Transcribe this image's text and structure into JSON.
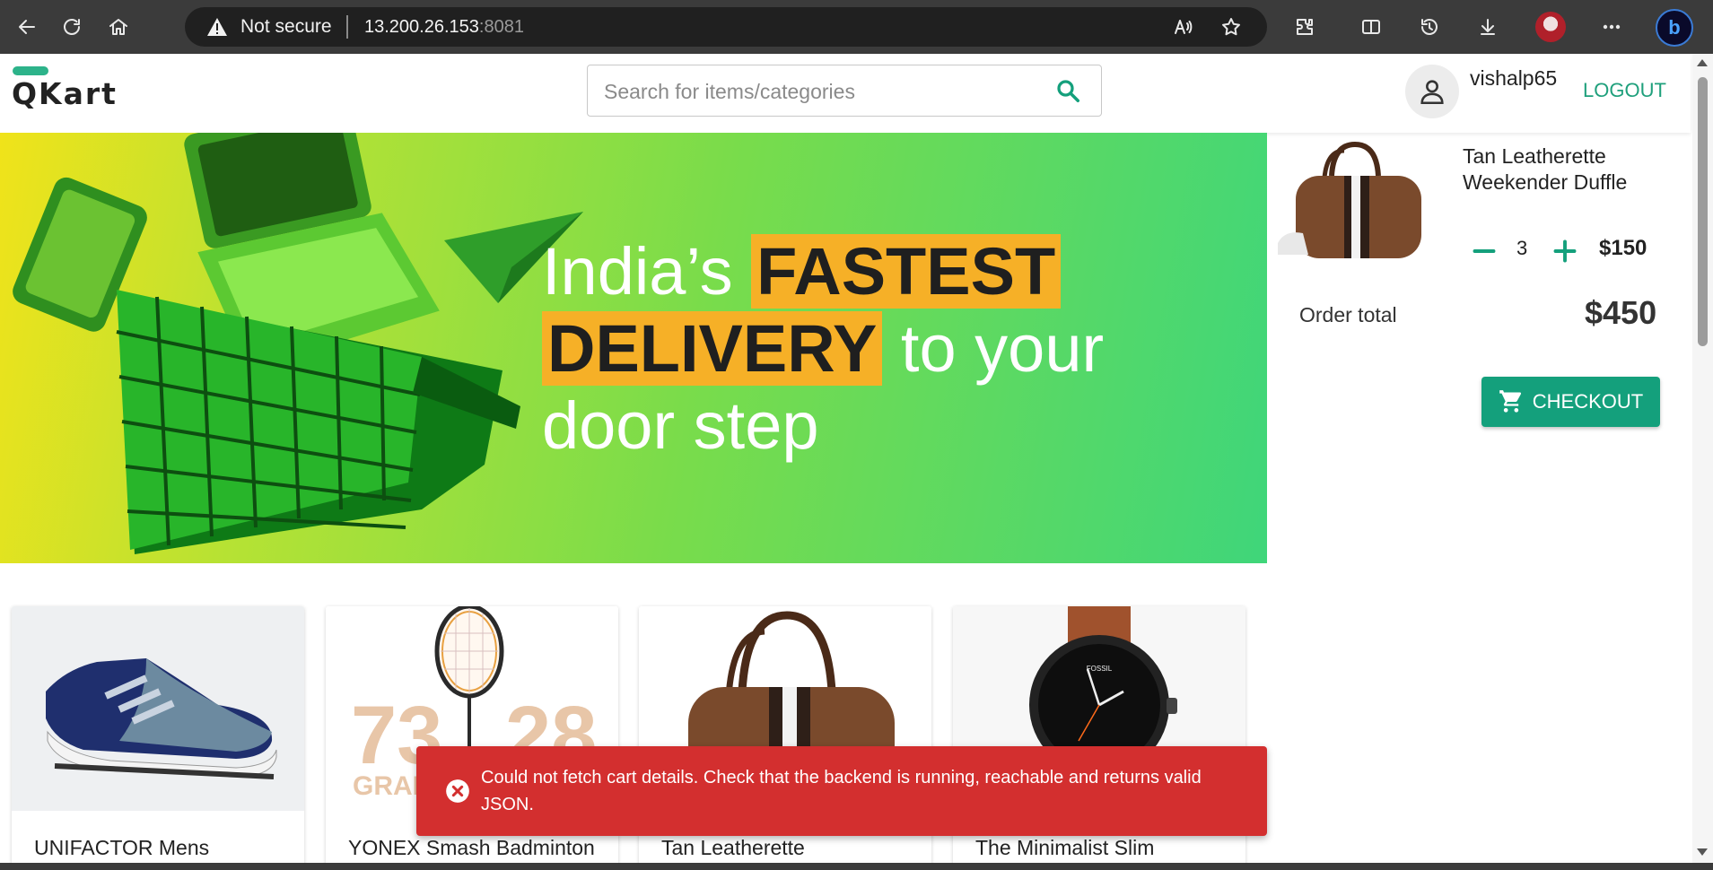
{
  "browser": {
    "security_label": "Not secure",
    "url_host": "13.200.26.153",
    "url_port": ":8081"
  },
  "header": {
    "logo": "QKart",
    "search": {
      "placeholder": "Search for items/categories",
      "value": ""
    },
    "username": "vishalp65",
    "logout_label": "LOGOUT"
  },
  "hero": {
    "line_pre": "India’s ",
    "highlight_1": "FASTEST",
    "highlight_2": "DELIVERY",
    "line_post": " to your door step"
  },
  "cart": {
    "items": [
      {
        "name": "Tan Leatherette Weekender Duffle",
        "quantity": "3",
        "price": "$150"
      }
    ],
    "order_total_label": "Order total",
    "order_total": "$450",
    "checkout_label": "CHECKOUT"
  },
  "products": [
    {
      "name": "UNIFACTOR Mens",
      "image": "shoe"
    },
    {
      "name": "YONEX Smash Badminton",
      "image": "racquet",
      "image_text_1": "73",
      "image_text_2": "28",
      "image_text_3": "GRAM"
    },
    {
      "name": "Tan Leatherette",
      "image": "duffle"
    },
    {
      "name": "The Minimalist Slim",
      "image": "watch",
      "image_text_1": "FOSSIL"
    }
  ],
  "toast": {
    "message": "Could not fetch cart details. Check that the backend is running, reachable and returns valid JSON."
  },
  "colors": {
    "brand": "#14a07c",
    "highlight": "#f6b027",
    "error": "#d32f2f"
  },
  "icons": [
    "back-icon",
    "refresh-icon",
    "home-icon",
    "warning-icon",
    "read-aloud-icon",
    "favorite-star-icon",
    "extensions-icon",
    "split-screen-icon",
    "history-icon",
    "download-icon",
    "profile-avatar",
    "more-icon",
    "bing-icon",
    "search-icon",
    "user-icon",
    "minus-icon",
    "plus-icon",
    "cart-icon",
    "error-icon"
  ]
}
